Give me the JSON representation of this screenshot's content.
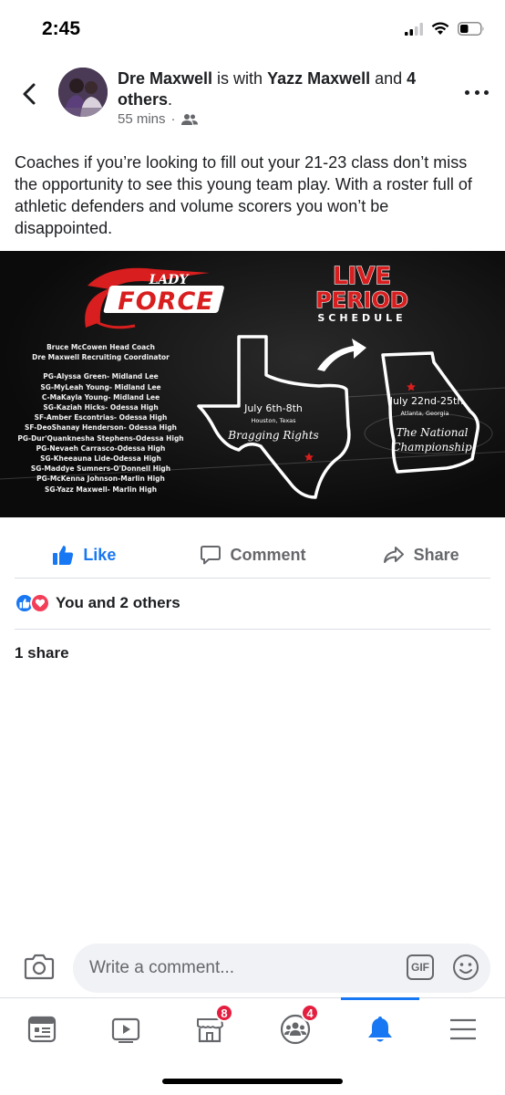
{
  "status_bar": {
    "time": "2:45"
  },
  "post": {
    "author": "Dre Maxwell",
    "with_text": " is with ",
    "tagged": "Yazz Maxwell",
    "and_text": " and ",
    "others": "4 others",
    "period": ".",
    "time_ago": "55 mins",
    "separator": "·",
    "audience_icon": "friends-icon",
    "text": "Coaches if you’re looking to fill out your 21-23 class don’t miss the opportunity to see this young team play.  With a roster full of athletic defenders and volume scorers you won’t be disappointed."
  },
  "flyer": {
    "logo_small": "LADY",
    "logo_big": "FORCE",
    "headline_1": "LIVE",
    "headline_2": "PERIOD",
    "headline_3": "SCHEDULE",
    "coaches": [
      "Bruce McCowen Head Coach",
      "Dre Maxwell Recruiting Coordinator"
    ],
    "roster": [
      "PG-Alyssa Green- Midland Lee",
      "SG-MyLeah Young- Midland Lee",
      "C-MaKayla Young- Midland Lee",
      "SG-Kaziah Hicks- Odessa High",
      "SF-Amber Escontrias- Odessa High",
      "SF-DeoShanay Henderson- Odessa High",
      "PG-Dur'Quanknesha Stephens-Odessa High",
      "PG-Nevaeh Carrasco-Odessa High",
      "SG-Kheeauna Lide-Odessa High",
      "SG-Maddye Sumners-O'Donnell High",
      "PG-McKenna Johnson-Marlin High",
      "SG-Yazz Maxwell- Marlin High"
    ],
    "event1_date": "July 6th-8th",
    "event1_place": "Houston, Texas",
    "event1_name": "Bragging Rights",
    "event2_date": "July 22nd-25th",
    "event2_place": "Atlanta, Georgia",
    "event2_name_1": "The National",
    "event2_name_2": "Championship"
  },
  "actions": {
    "like": "Like",
    "comment": "Comment",
    "share": "Share"
  },
  "reactions": {
    "text": "You and 2 others",
    "icons": [
      "like-reaction-icon",
      "love-reaction-icon"
    ]
  },
  "shares": "1 share",
  "comment_box": {
    "placeholder": "Write a comment...",
    "gif_label": "GIF"
  },
  "bottom_nav": {
    "items": [
      {
        "icon": "news-feed-icon"
      },
      {
        "icon": "watch-icon"
      },
      {
        "icon": "marketplace-icon",
        "badge": "8"
      },
      {
        "icon": "groups-icon",
        "badge": "4"
      },
      {
        "icon": "notifications-icon"
      },
      {
        "icon": "menu-icon"
      }
    ]
  },
  "colors": {
    "accent": "#1877f2",
    "badge": "#e41e3f",
    "flyer_red": "#d81e1e"
  }
}
